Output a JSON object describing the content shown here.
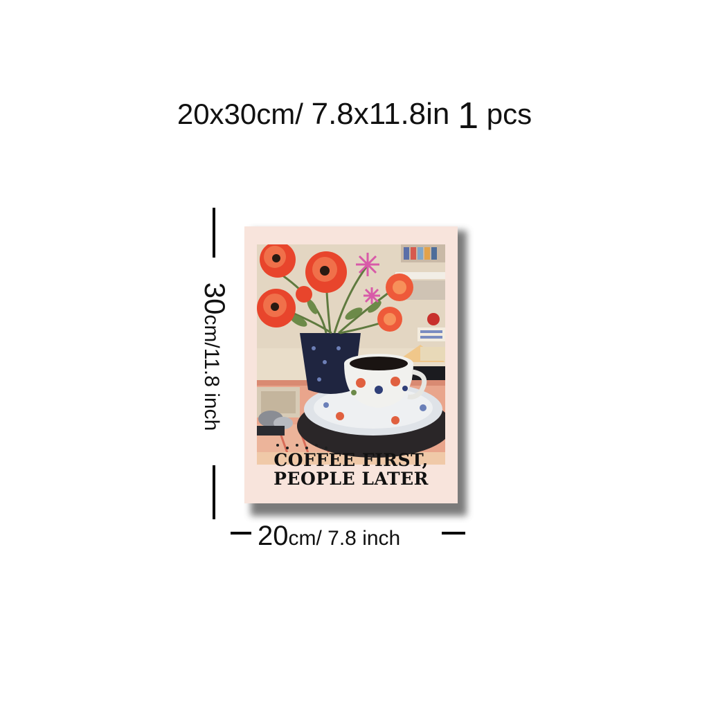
{
  "header": {
    "size_cm": "20x30cm/",
    "size_in": "7.8x11.8in",
    "quantity": "1",
    "unit": "pcs"
  },
  "poster": {
    "caption_line1": "COFFEE FIRST,",
    "caption_line2": "PEOPLE LATER"
  },
  "dimensions": {
    "height_value": "30",
    "height_unit": "cm/11.8 inch",
    "width_value": "20",
    "width_unit": "cm/ 7.8 inch"
  },
  "colors": {
    "poster_background": "#f8e4dc",
    "flower_red": "#e8452c",
    "vase_navy": "#1f2540",
    "accent_pink": "#d85aa8"
  }
}
